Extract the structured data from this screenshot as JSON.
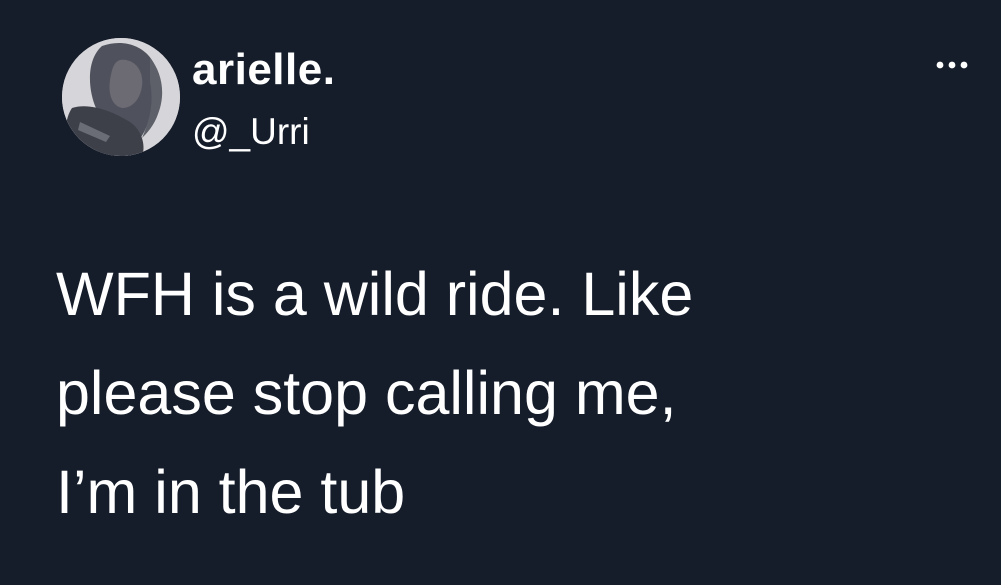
{
  "tweet": {
    "author": {
      "display_name": "arielle.",
      "handle": "@_Urri",
      "avatar_icon": "profile-photo"
    },
    "more_icon": "more-dots-icon",
    "text": "WFH is a wild ride. Like\nplease stop calling me,\nI’m in the tub"
  },
  "colors": {
    "background": "#151d2b",
    "text": "#ffffff"
  }
}
